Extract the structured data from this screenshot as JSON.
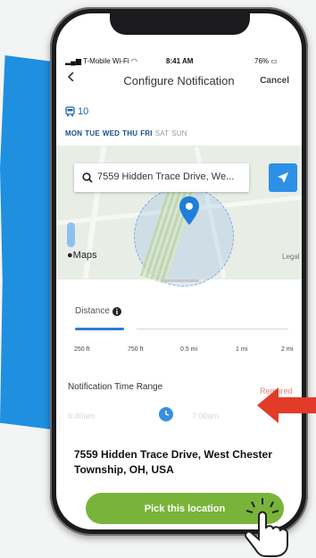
{
  "status_bar": {
    "carrier": "T-Mobile Wi-Fi",
    "time": "8:41 AM",
    "battery": "76%"
  },
  "header": {
    "title": "Configure Notification",
    "cancel_label": "Cancel"
  },
  "route": {
    "number": "10",
    "icon": "bus-icon"
  },
  "days": [
    {
      "label": "MON",
      "active": true
    },
    {
      "label": "TUE",
      "active": true
    },
    {
      "label": "WED",
      "active": true
    },
    {
      "label": "THU",
      "active": true
    },
    {
      "label": "FRI",
      "active": true
    },
    {
      "label": "SAT",
      "active": false
    },
    {
      "label": "SUN",
      "active": false
    }
  ],
  "search": {
    "value": "7559 Hidden Trace Drive, We..."
  },
  "map": {
    "logo": "Maps",
    "legal": "Legal"
  },
  "distance": {
    "label": "Distance",
    "ticks": [
      "250 ft",
      "750 ft",
      "0.5 mi",
      "1 mi",
      "2 mi"
    ],
    "selected_index": 0
  },
  "time_range": {
    "label": "Notification Time Range",
    "required": "Required",
    "start": "6:40am",
    "end": "7:00am"
  },
  "address": "7559 Hidden Trace Drive, West Chester Township, OH, USA",
  "pick_label": "Pick this location",
  "colors": {
    "accent": "#2e8fe6",
    "pick": "#79b43a",
    "required": "#e57d79",
    "arrow": "#e23b27",
    "brush": "#1f8fe0"
  }
}
